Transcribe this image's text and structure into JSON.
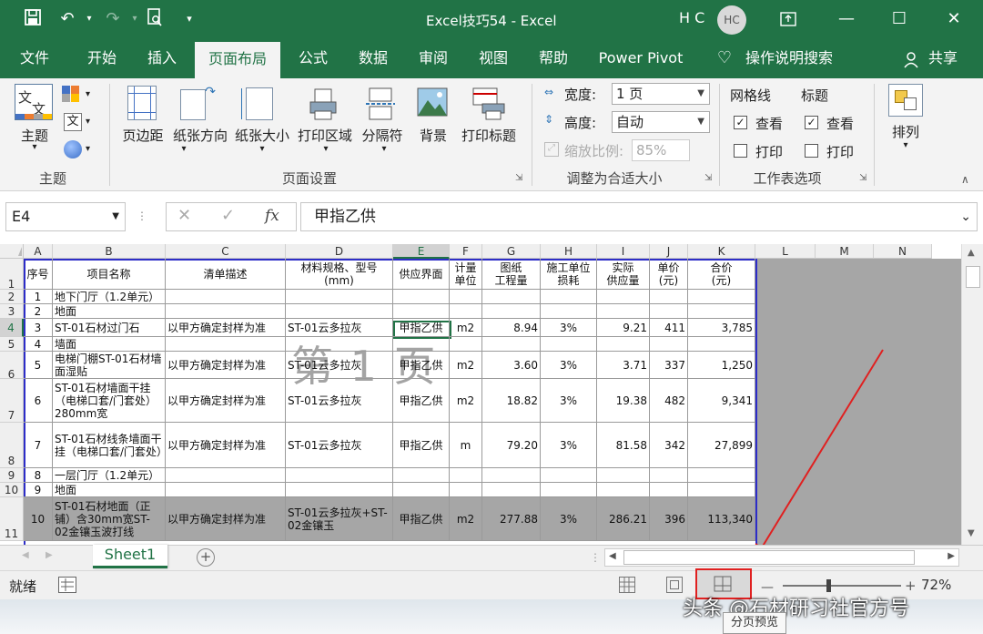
{
  "titlebar": {
    "title": "Excel技巧54  -  Excel",
    "user_initials": "H C",
    "avatar_text": "HC"
  },
  "menu": {
    "tabs": [
      "文件",
      "开始",
      "插入",
      "页面布局",
      "公式",
      "数据",
      "审阅",
      "视图",
      "帮助",
      "Power Pivot"
    ],
    "active": "页面布局",
    "tell_me": "操作说明搜索",
    "share": "共享"
  },
  "ribbon": {
    "theme": {
      "label": "主题",
      "group": "主题"
    },
    "page_setup": {
      "buttons": [
        "页边距",
        "纸张方向",
        "纸张大小",
        "打印区域",
        "分隔符",
        "背景",
        "打印标题"
      ],
      "group": "页面设置"
    },
    "scale": {
      "width_label": "宽度:",
      "width_value": "1 页",
      "height_label": "高度:",
      "height_value": "自动",
      "zoom_label": "缩放比例:",
      "zoom_value": "85%",
      "group": "调整为合适大小"
    },
    "sheet_options": {
      "gridlines": "网格线",
      "headings": "标题",
      "view": "查看",
      "print": "打印",
      "group": "工作表选项"
    },
    "arrange": {
      "label": "排列"
    }
  },
  "formula_bar": {
    "name_box": "E4",
    "fx": "fx",
    "value": "甲指乙供"
  },
  "grid": {
    "columns": [
      "A",
      "B",
      "C",
      "D",
      "E",
      "F",
      "G",
      "H",
      "I",
      "J",
      "K",
      "L",
      "M",
      "N"
    ],
    "watermark": "第 1 页",
    "headers": [
      "序号",
      "项目名称",
      "清单描述",
      "材料规格、型号\n(mm)",
      "供应界面",
      "计量\n单位",
      "图纸\n工程量",
      "施工单位\n损耗",
      "实际\n供应量",
      "单价\n(元)",
      "合价\n(元)"
    ],
    "rows": [
      {
        "num": "2",
        "cells": [
          "1",
          "地下门厅（1.2单元）",
          "",
          "",
          "",
          "",
          "",
          "",
          "",
          "",
          ""
        ]
      },
      {
        "num": "3",
        "cells": [
          "2",
          "地面",
          "",
          "",
          "",
          "",
          "",
          "",
          "",
          "",
          ""
        ]
      },
      {
        "num": "4",
        "cells": [
          "3",
          "ST-01石材过门石",
          "以甲方确定封样为准",
          "ST-01云多拉灰",
          "甲指乙供",
          "m2",
          "8.94",
          "3%",
          "9.21",
          "411",
          "3,785"
        ]
      },
      {
        "num": "5",
        "cells": [
          "4",
          "墙面",
          "",
          "",
          "",
          "",
          "",
          "",
          "",
          "",
          ""
        ]
      },
      {
        "num": "6",
        "cells": [
          "5",
          "电梯门棚ST-01石材墙面湿贴",
          "以甲方确定封样为准",
          "ST-01云多拉灰",
          "甲指乙供",
          "m2",
          "3.60",
          "3%",
          "3.71",
          "337",
          "1,250"
        ]
      },
      {
        "num": "7",
        "cells": [
          "6",
          "ST-01石材墙面干挂（电梯口套/门套处）280mm宽",
          "以甲方确定封样为准",
          "ST-01云多拉灰",
          "甲指乙供",
          "m2",
          "18.82",
          "3%",
          "19.38",
          "482",
          "9,341"
        ]
      },
      {
        "num": "8",
        "cells": [
          "7",
          "ST-01石材线条墙面干挂（电梯口套/门套处）",
          "以甲方确定封样为准",
          "ST-01云多拉灰",
          "甲指乙供",
          "m",
          "79.20",
          "3%",
          "81.58",
          "342",
          "27,899"
        ]
      },
      {
        "num": "9",
        "cells": [
          "8",
          "一层门厅（1.2单元）",
          "",
          "",
          "",
          "",
          "",
          "",
          "",
          "",
          ""
        ]
      },
      {
        "num": "10",
        "cells": [
          "9",
          "地面",
          "",
          "",
          "",
          "",
          "",
          "",
          "",
          "",
          ""
        ]
      },
      {
        "num": "11",
        "cells": [
          "10",
          "ST-01石材地面（正铺）含30mm宽ST-02金镶玉波打线",
          "以甲方确定封样为准",
          "ST-01云多拉灰+ST-02金镶玉",
          "甲指乙供",
          "m2",
          "277.88",
          "3%",
          "286.21",
          "396",
          "113,340"
        ]
      }
    ]
  },
  "sheet_tabs": {
    "active": "Sheet1",
    "add": "+"
  },
  "status": {
    "ready": "就绪",
    "zoom": "72%",
    "tooltip": "分页预览"
  },
  "watermark_footer": "头条 @石材研习社官方号",
  "colors": {
    "excel_green": "#217346",
    "page_border": "#2d2dc8",
    "arrow": "#e02020"
  }
}
